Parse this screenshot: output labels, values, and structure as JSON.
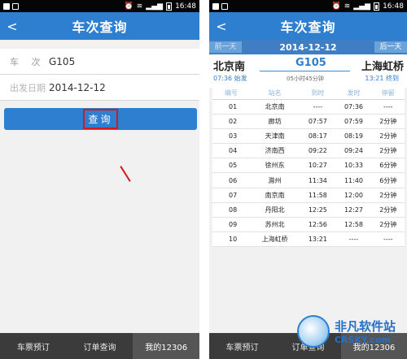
{
  "left": {
    "status_time": "16:48",
    "title": "车次查询",
    "back": "<",
    "fields": [
      {
        "label": "车 次",
        "value": "G105"
      },
      {
        "label": "出发日期",
        "value": "2014-12-12"
      }
    ],
    "query_button": "查询",
    "nav": [
      "车票预订",
      "订单查询",
      "我的12306"
    ]
  },
  "right": {
    "status_time": "16:48",
    "title": "车次查询",
    "back": "<",
    "prev_day": "前一天",
    "date": "2014-12-12",
    "next_day": "后一天",
    "from_station": "北京南",
    "train_no": "G105",
    "to_station": "上海虹桥",
    "depart": "07:36 始发",
    "duration": "05小时45分钟",
    "arrive": "13:21 终到",
    "columns": [
      "编号",
      "站名",
      "到时",
      "发时",
      "停留"
    ],
    "stops": [
      [
        "01",
        "北京南",
        "----",
        "07:36",
        "----"
      ],
      [
        "02",
        "廊坊",
        "07:57",
        "07:59",
        "2分钟"
      ],
      [
        "03",
        "天津南",
        "08:17",
        "08:19",
        "2分钟"
      ],
      [
        "04",
        "济南西",
        "09:22",
        "09:24",
        "2分钟"
      ],
      [
        "05",
        "徐州东",
        "10:27",
        "10:33",
        "6分钟"
      ],
      [
        "06",
        "滁州",
        "11:34",
        "11:40",
        "6分钟"
      ],
      [
        "07",
        "南京南",
        "11:58",
        "12:00",
        "2分钟"
      ],
      [
        "08",
        "丹阳北",
        "12:25",
        "12:27",
        "2分钟"
      ],
      [
        "09",
        "苏州北",
        "12:56",
        "12:58",
        "2分钟"
      ],
      [
        "10",
        "上海虹桥",
        "13:21",
        "----",
        "----"
      ]
    ],
    "nav": [
      "车票预订",
      "订单查询",
      "我的12306"
    ]
  },
  "watermark": {
    "cn": "非凡软件站",
    "en": "CRSKY.com"
  },
  "colors": {
    "accent": "#2f7fd0",
    "highlight": "#d21a1a",
    "nav_bg": "#3b3b3b"
  }
}
